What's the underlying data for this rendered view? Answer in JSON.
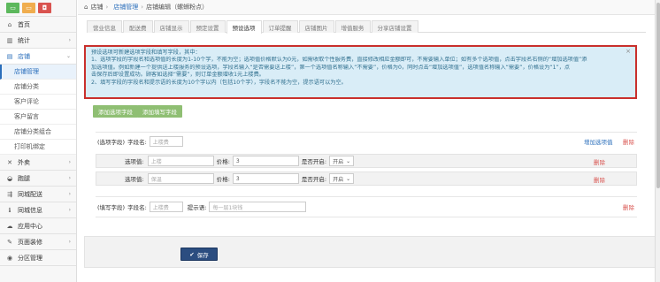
{
  "colors": {
    "accent": "#2a6ebb",
    "danger": "#d9534f",
    "green": "#8fbf73",
    "save": "#2b4d80",
    "alert_bg": "#d9edf7",
    "alert_border": "#c9302c",
    "btn_green2": "#5cb85c",
    "btn_orange": "#f0ad4e",
    "btn_red": "#d9534f"
  },
  "sidebar": {
    "top_icons": [
      "monitor-icon",
      "monitor-icon",
      "bag-icon"
    ],
    "items": [
      {
        "icon": "home-icon",
        "label": "首页"
      },
      {
        "icon": "bar-chart-icon",
        "label": "统计"
      },
      {
        "icon": "shop-icon",
        "label": "店铺"
      }
    ],
    "sub_items": [
      "店铺管理",
      "店铺分类",
      "客户评论",
      "客户留言",
      "店铺分类组合",
      "打印机绑定"
    ],
    "items_after": [
      {
        "icon": "cutlery-icon",
        "label": "外卖"
      },
      {
        "icon": "car-icon",
        "label": "跑腿"
      },
      {
        "icon": "share-icon",
        "label": "同城配送"
      },
      {
        "icon": "info-icon",
        "label": "同城信息"
      },
      {
        "icon": "cloud-icon",
        "label": "应用中心"
      },
      {
        "icon": "palette-icon",
        "label": "页面装修"
      },
      {
        "icon": "globe-icon",
        "label": "分区管理"
      }
    ]
  },
  "breadcrumb": {
    "root": "店铺",
    "mid": "店铺管理",
    "current": "店铺编辑（螺蛳粉点）"
  },
  "tabs": [
    "营业信息",
    "配送费",
    "店铺显示",
    "预定设置",
    "预设选项",
    "订单提醒",
    "店铺图片",
    "增值服务",
    "分享店铺设置"
  ],
  "active_tab": 4,
  "alert": {
    "line1": "预设选项可新建选项字段和填写字段，其中：",
    "line2": "1、选项字段的字段名和选项值的长度为1-10个字，不能为空；选项值价格默认为0元，如需收取个性服务费，直接修改相应金额即可，不需要输入单位；如有多个选项值，点击字段名右侧的“增加选项值”添",
    "line3": "加选项值。例如新建一个提供送上楼服务的预设选项，字段名输入“是否需要送上楼”，第一个选项值名称输入“不需要”，价格为0，同时点击“增加选项值”，选项值名称输入“需要”，价格设为“1”，点",
    "line4": "击保存后即设置成功。顾客如选择“需要”，则订单金额增收1元上楼费。",
    "line5": "2、填写字段的字段名和提示语的长度为10个字以内（包括10个字），字段名不能为空，提示语可以为空。"
  },
  "buttons": {
    "add_option_field": "添加选项字段",
    "add_input_field": "添加填写字段",
    "save": "保存"
  },
  "option_field": {
    "tag": "(选项字段)",
    "name_label": "字段名:",
    "name_placeholder": "上楼费",
    "add_value": "增加选项值",
    "delete": "删除",
    "values": [
      {
        "label": "选项值:",
        "value": "上楼",
        "price_label": "价格:",
        "price": "3",
        "open_label": "是否开启:",
        "open": "开启",
        "delete": "删除"
      },
      {
        "label": "选项值:",
        "value": "保温",
        "price_label": "价格:",
        "price": "3",
        "open_label": "是否开启:",
        "open": "开启",
        "delete": "删除"
      }
    ]
  },
  "input_field": {
    "tag": "(填写字段)",
    "name_label": "字段名:",
    "name_placeholder": "上楼费",
    "hint_label": "提示语:",
    "hint_placeholder": "每一层1块钱",
    "delete": "删除"
  }
}
